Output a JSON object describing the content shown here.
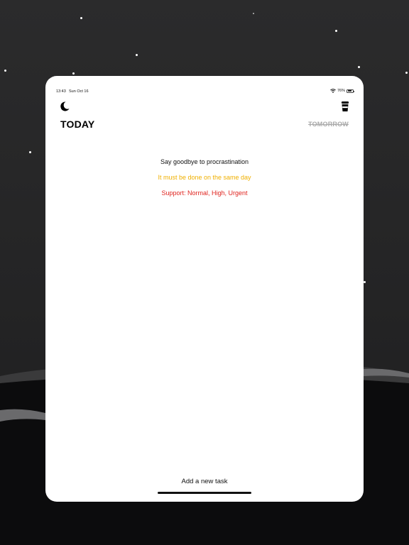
{
  "status_bar": {
    "time": "13:43",
    "date": "Sun Oct 16",
    "battery": "76%",
    "battery_level": 0.76,
    "wifi_icon": "wifi-icon",
    "battery_icon": "battery-icon"
  },
  "header": {
    "theme_icon": "moon-icon",
    "cup_icon": "coffee-cup-icon"
  },
  "tabs": {
    "today": "TODAY",
    "tomorrow": "TOMORROW"
  },
  "empty_state": {
    "line1": "Say goodbye to procrastination",
    "line2": "It must be done on the same day",
    "line3": "Support: Normal, High, Urgent"
  },
  "footer": {
    "add_task": "Add a new task"
  },
  "colors": {
    "accent_yellow": "#f0b000",
    "accent_red": "#e0241f",
    "disabled_gray": "#a9a9a9",
    "background_dark": "#262627"
  }
}
